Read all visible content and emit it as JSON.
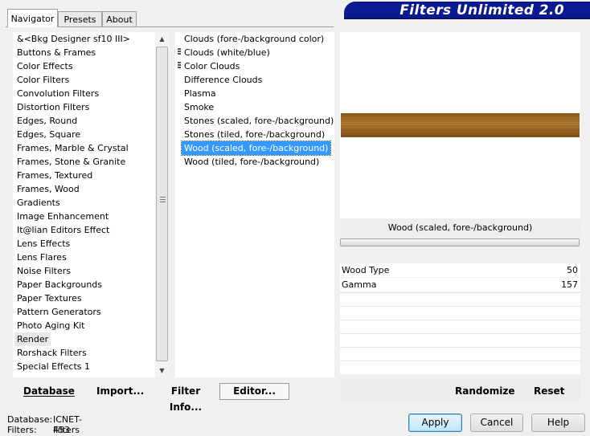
{
  "tabs": [
    {
      "label": "Navigator",
      "active": true
    },
    {
      "label": "Presets",
      "active": false
    },
    {
      "label": "About",
      "active": false
    }
  ],
  "banner_title": "Filters Unlimited 2.0",
  "categories": [
    "&<Bkg Designer sf10 III>",
    "Buttons & Frames",
    "Color Effects",
    "Color Filters",
    "Convolution Filters",
    "Distortion Filters",
    "Edges, Round",
    "Edges, Square",
    "Frames, Marble & Crystal",
    "Frames, Stone & Granite",
    "Frames, Textured",
    "Frames, Wood",
    "Gradients",
    "Image Enhancement",
    "It@lian Editors Effect",
    "Lens Effects",
    "Lens Flares",
    "Noise Filters",
    "Paper Backgrounds",
    "Paper Textures",
    "Pattern Generators",
    "Photo Aging Kit",
    "Render",
    "Rorshack Filters",
    "Special Effects 1"
  ],
  "highlighted_category": "Render",
  "filters": [
    "Clouds (fore-/background color)",
    "Clouds (white/blue)",
    "Color Clouds",
    "Difference Clouds",
    "Plasma",
    "Smoke",
    "Stones (scaled, fore-/background)",
    "Stones (tiled, fore-/background)",
    "Wood (scaled, fore-/background)",
    "Wood (tiled, fore-/background)"
  ],
  "selected_filter": "Wood (scaled, fore-/background)",
  "preview": {
    "filter_name": "Wood (scaled, fore-/background)"
  },
  "params": [
    {
      "name": "Wood Type",
      "value": "50"
    },
    {
      "name": "Gamma",
      "value": "157"
    }
  ],
  "buttons": {
    "database": "Database",
    "import": "Import...",
    "filter_info": "Filter Info...",
    "editor": "Editor...",
    "randomize": "Randomize",
    "reset": "Reset",
    "apply": "Apply",
    "cancel": "Cancel",
    "help": "Help"
  },
  "status": {
    "database_label": "Database:",
    "database_value": "ICNET-Filters",
    "filters_label": "Filters:",
    "filters_value": "453"
  },
  "colors": {
    "banner": "#0b1a8f",
    "selection": "#3399ff"
  }
}
